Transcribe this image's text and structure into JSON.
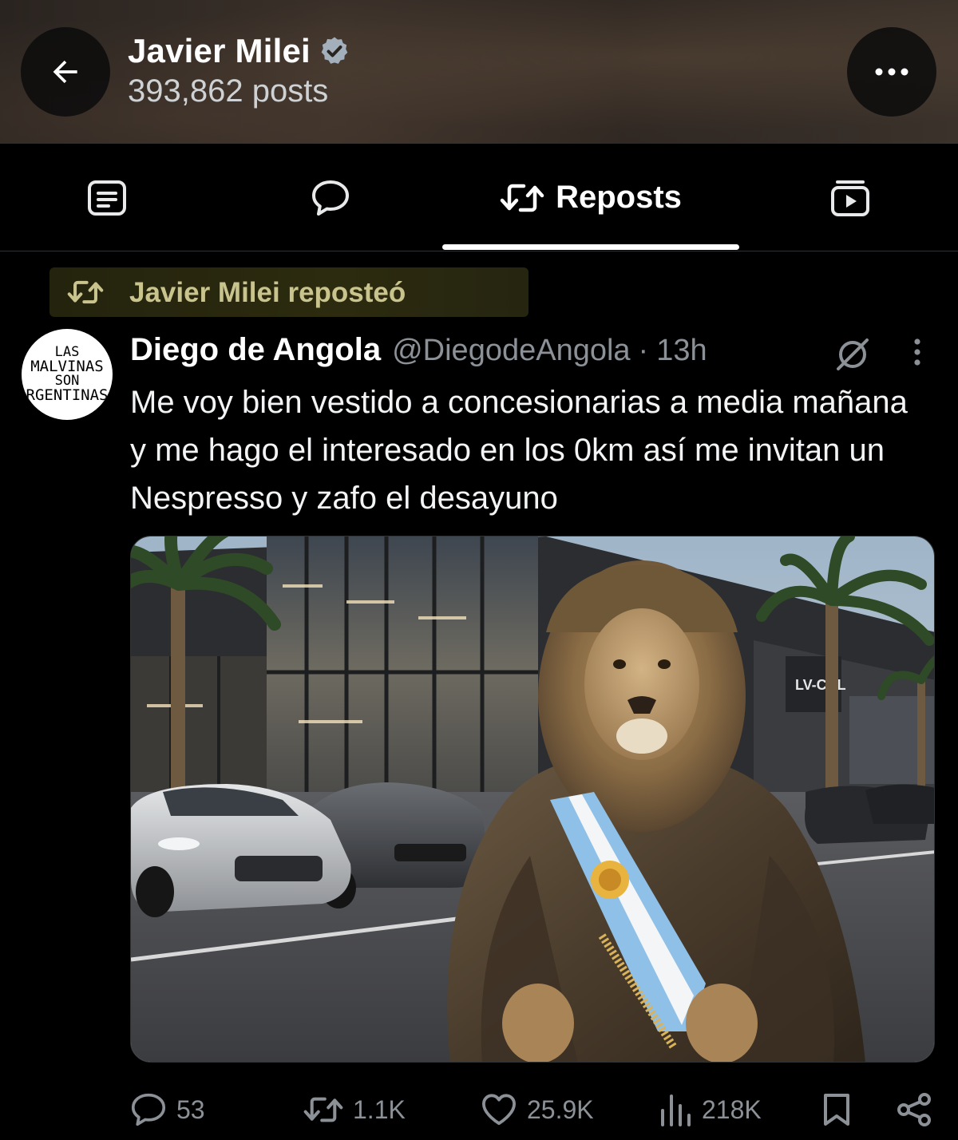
{
  "header": {
    "profile_name": "Javier Milei",
    "verified": true,
    "post_count": "393,862 posts",
    "back_icon": "arrow-left-icon",
    "more_icon": "more-horizontal-icon"
  },
  "tabs": [
    {
      "name": "posts",
      "icon": "article-icon",
      "label": ""
    },
    {
      "name": "replies",
      "icon": "speech-bubble-icon",
      "label": ""
    },
    {
      "name": "reposts",
      "icon": "repost-icon",
      "label": "Reposts",
      "active": true
    },
    {
      "name": "media",
      "icon": "video-icon",
      "label": ""
    }
  ],
  "repost_context": {
    "text": "Javier Milei reposteó",
    "highlight_color": "#2c2b0f"
  },
  "tweet": {
    "avatar_text": [
      "LAS",
      "MALVINAS",
      "SON",
      "RGENTINAS"
    ],
    "author_name": "Diego de Angola",
    "handle": "@DiegodeAngola",
    "separator": "·",
    "time": "13h",
    "text": "Me voy bien vestido a concesionarias a media mañana y me hago el interesado en los 0km así me invitan un Nespresso y zafo el desayuno",
    "image": {
      "sign_text": "LV-CRL"
    }
  },
  "actions": {
    "replies": "53",
    "reposts": "1.1K",
    "likes": "25.9K",
    "views": "218K"
  },
  "colors": {
    "background": "#000000",
    "text_primary": "#e7e9ea",
    "text_secondary": "#8b9197",
    "verified_badge": "#a3b0bb"
  }
}
